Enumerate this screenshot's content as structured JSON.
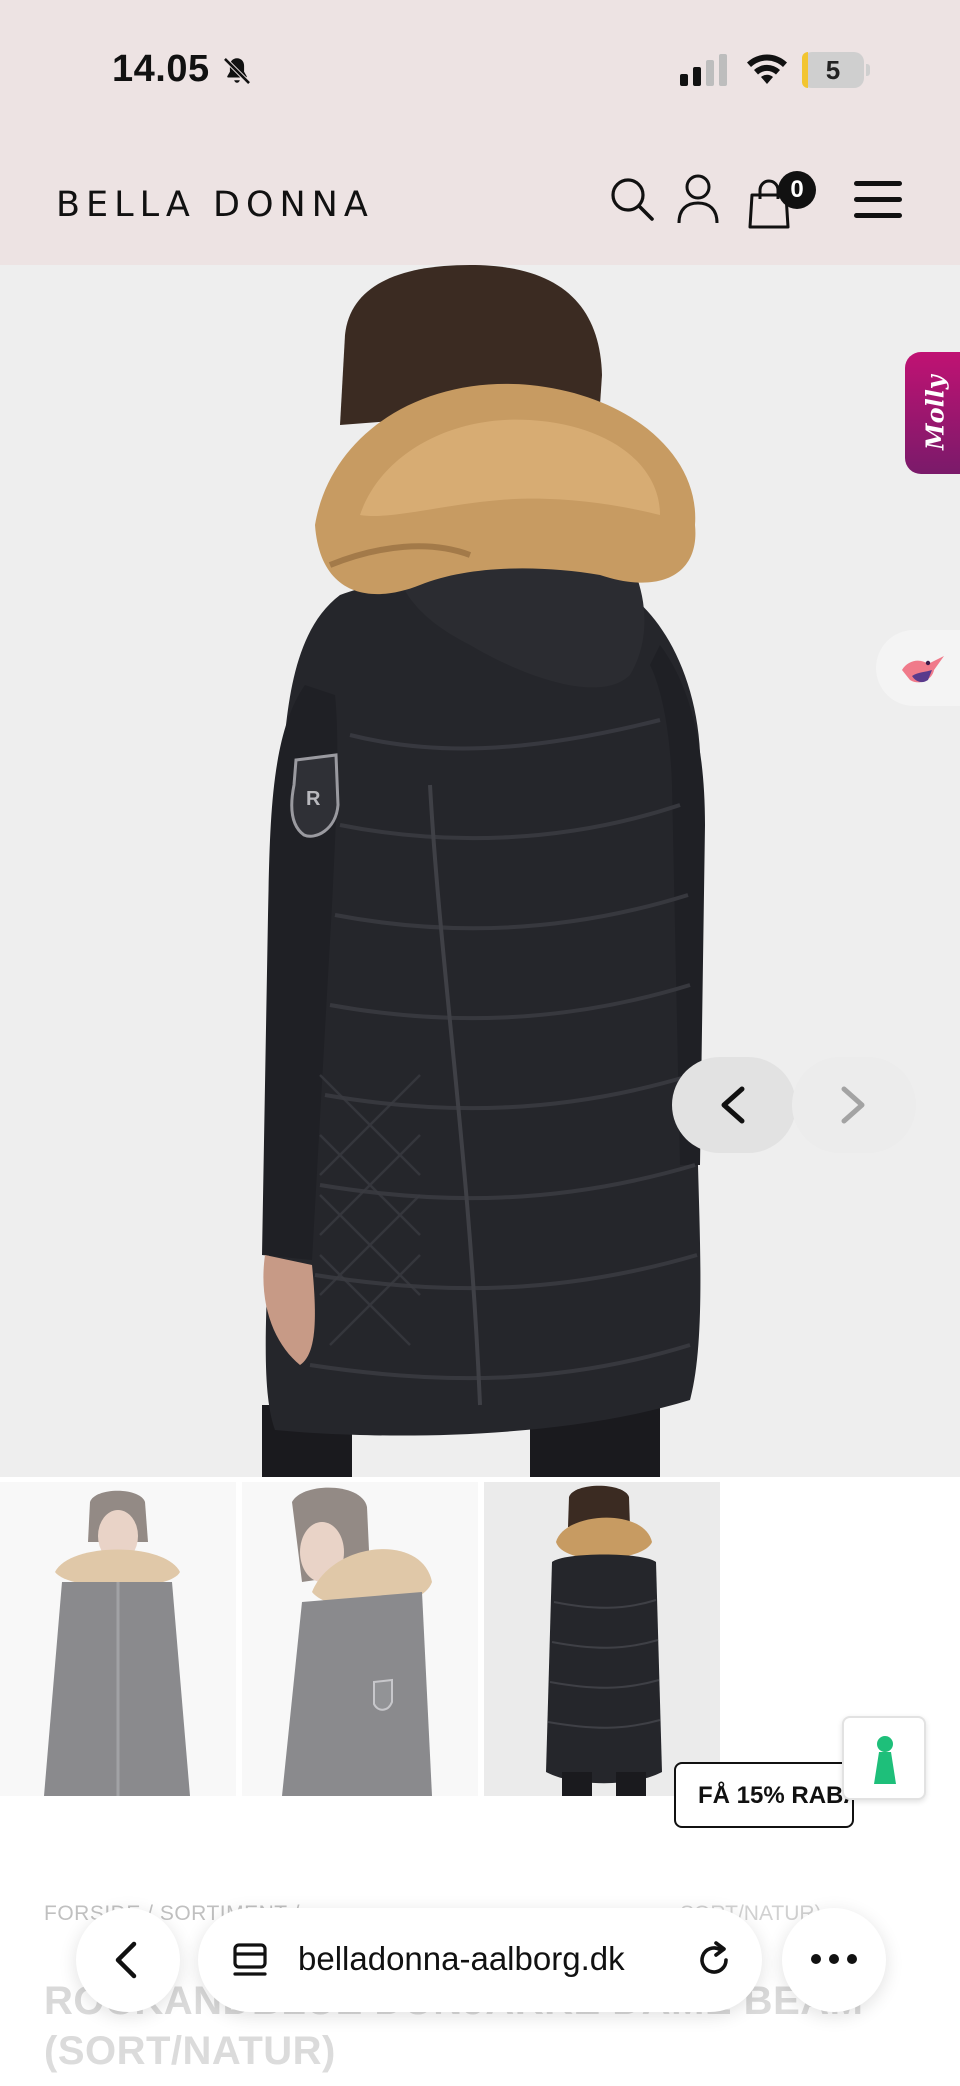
{
  "status_bar": {
    "time": "14.05",
    "battery_level": "5",
    "icons": [
      "bell-muted-icon",
      "cellular-signal-icon",
      "wifi-icon",
      "battery-icon"
    ]
  },
  "header": {
    "logo": "BELLA DONNA",
    "cart_count": "0",
    "icons": [
      "search-icon",
      "account-icon",
      "cart-icon",
      "menu-icon"
    ]
  },
  "gallery": {
    "molly_label": "Molly",
    "thumbnail_count": 3,
    "active_thumbnail": 3,
    "icons": [
      "chevron-left-icon",
      "chevron-right-icon",
      "bird-chat-icon"
    ]
  },
  "promo": {
    "discount_label": "FÅ 15% RABA",
    "gift_icon": "gift-icon"
  },
  "product": {
    "breadcrumb": "FORSIDE / SORTIMENT /",
    "breadcrumb_tail": "SORT/NATUR)",
    "title": "ROCKANDBLUE DUNJAKKE DAME BEAM (SORT/NATUR)"
  },
  "browser": {
    "url": "belladonna-aalborg.dk",
    "icons": [
      "back-icon",
      "tabs-icon",
      "reload-icon",
      "more-icon"
    ]
  },
  "colors": {
    "header_bg": "#ede3e3",
    "molly_accent": "#c01273",
    "gift_accent": "#1ebf7a"
  }
}
